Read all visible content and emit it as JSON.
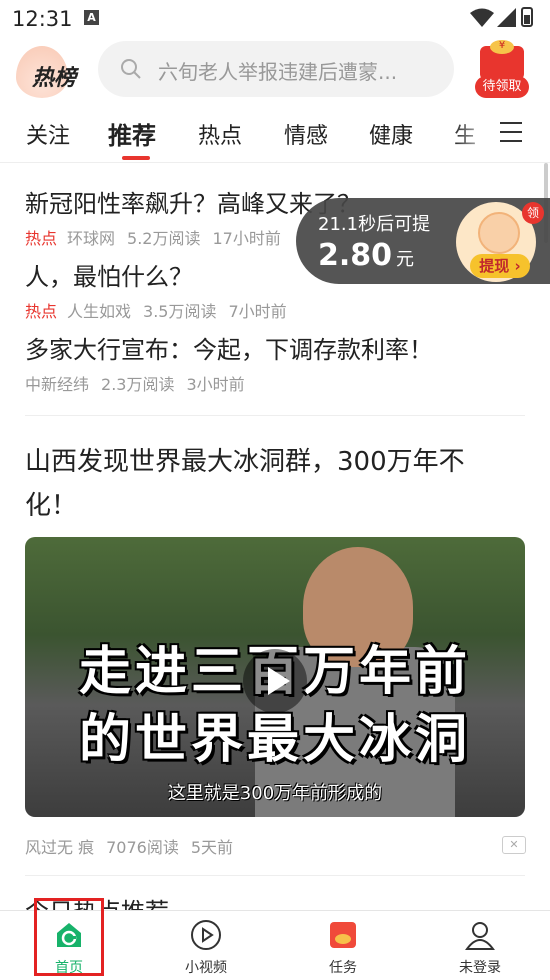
{
  "status_bar": {
    "time": "12:31",
    "notif_icon": "a-notification-icon"
  },
  "header": {
    "logo_text": "热榜",
    "search_placeholder": "六旬老人举报违建后遭蒙...",
    "redpack_label": "待领取",
    "redpack_symbol": "¥"
  },
  "tabs": [
    {
      "label": "关注",
      "active": false
    },
    {
      "label": "推荐",
      "active": true
    },
    {
      "label": "热点",
      "active": false
    },
    {
      "label": "情感",
      "active": false
    },
    {
      "label": "健康",
      "active": false
    },
    {
      "label": "生",
      "active": false
    }
  ],
  "promo": {
    "countdown_text": "21.1秒后可提",
    "amount": "2.80",
    "unit": "元",
    "button": "提现",
    "badge": "领"
  },
  "feed": {
    "articles": [
      {
        "title": "新冠阳性率飙升？高峰又来了？",
        "tag": "热点",
        "source": "环球网",
        "reads": "5.2万阅读",
        "time": "17小时前"
      },
      {
        "title": "人，最怕什么？",
        "tag": "热点",
        "source": "人生如戏",
        "reads": "3.5万阅读",
        "time": "7小时前"
      },
      {
        "title": "多家大行宣布：今起，下调存款利率！",
        "tag": "",
        "source": "中新经纬",
        "reads": "2.3万阅读",
        "time": "3小时前"
      }
    ],
    "video_article": {
      "title": "山西发现世界最大冰洞群，300万年不化！",
      "caption_line1": "走进三百万年前",
      "caption_line2": "的世界最大冰洞",
      "subtitle": "这里就是300万年前形成的",
      "source": "风过无 痕",
      "reads": "7076阅读",
      "time": "5天前"
    },
    "next_section_title": "今日热点推荐"
  },
  "bottom_nav": [
    {
      "label": "首页",
      "icon": "home-icon",
      "active": true
    },
    {
      "label": "小视频",
      "icon": "play-circle-icon",
      "active": false
    },
    {
      "label": "任务",
      "icon": "task-redpack-icon",
      "active": false
    },
    {
      "label": "未登录",
      "icon": "user-icon",
      "active": false
    }
  ],
  "colors": {
    "accent_red": "#e8352e",
    "active_green": "#17b26a",
    "highlight_box": "#e32222"
  }
}
